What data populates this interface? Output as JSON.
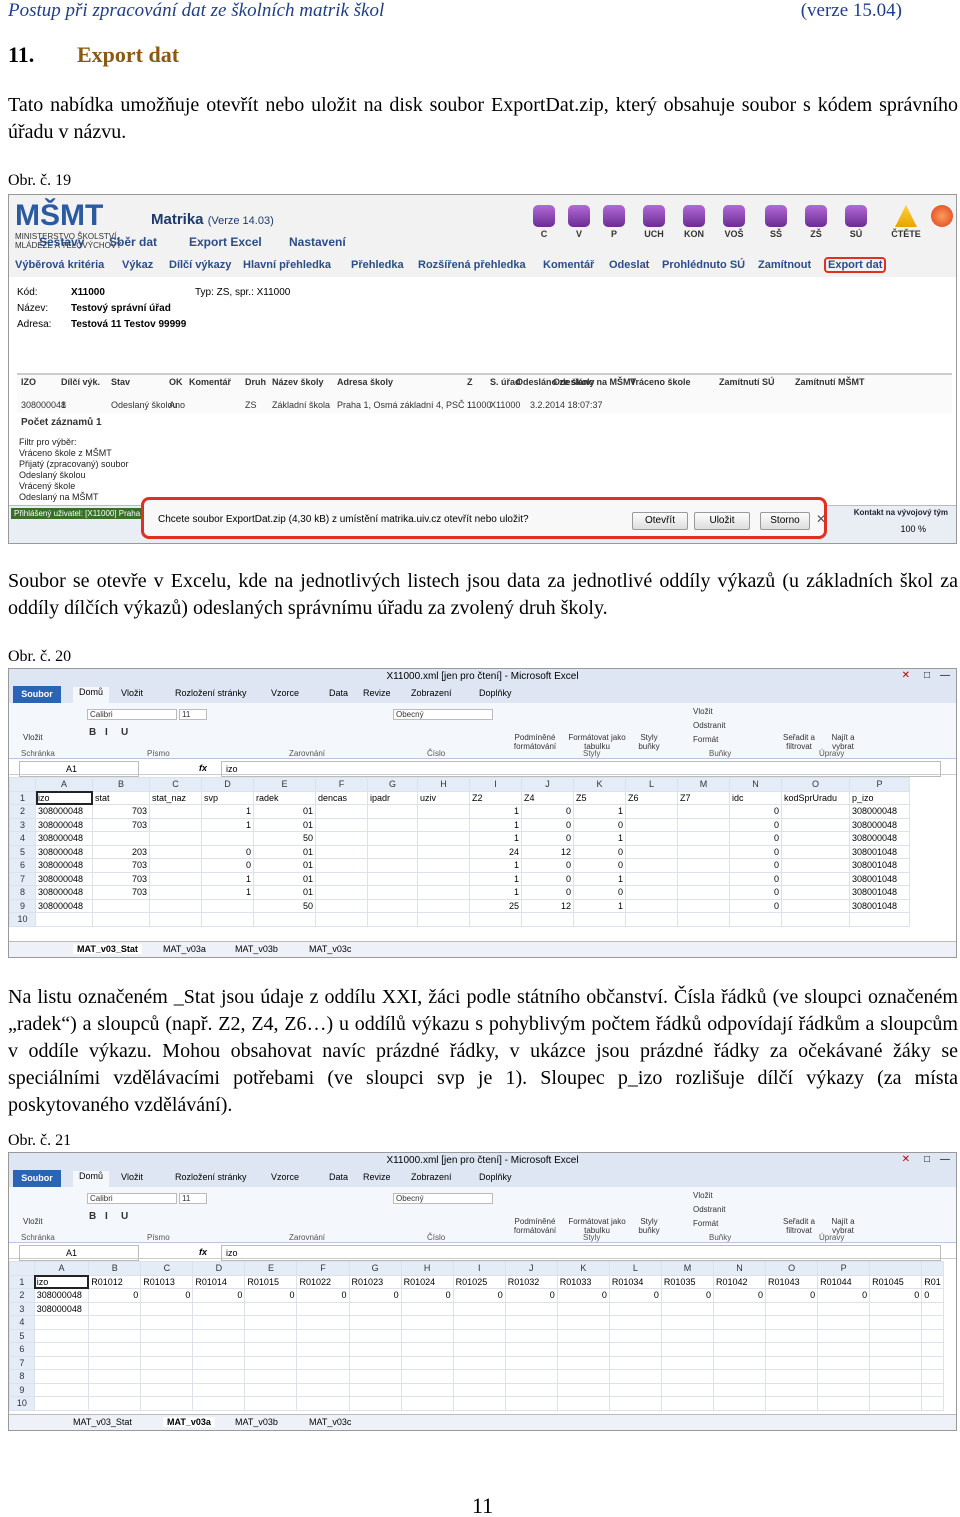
{
  "header": {
    "title": "Postup při zpracování dat ze školních matrik škol",
    "version": "(verze 15.04)"
  },
  "section": {
    "number": "11.",
    "title": "Export dat"
  },
  "para1": "Tato nabídka umožňuje otevřít nebo uložit na disk soubor ExportDat.zip, který obsahuje soubor s kódem správního úřadu v názvu.",
  "cap19": "Obr. č. 19",
  "para2": "Soubor se otevře v Excelu, kde na jednotlivých listech jsou data za jednotlivé oddíly výkazů (u základních škol za oddíly dílčích výkazů) odeslaných správnímu úřadu za zvolený druh školy.",
  "cap20": "Obr. č. 20",
  "para3": "Na listu označeném _Stat jsou údaje z oddílu XXI, žáci podle státního občanství. Čísla řádků (ve sloupci označeném „radek“) a sloupců (např. Z2, Z4, Z6…) u oddílů výkazu s pohyblivým počtem řádků odpovídají řádkům a sloupcům v oddíle výkazu. Mohou obsahovat navíc prázdné řádky, v ukázce jsou prázdné řádky za očekávané žáky se speciálními vzdělávacími potřebami (ve sloupci svp je 1). Sloupec p_izo rozlišuje dílčí výkazy (za místa poskytovaného vzdělávání).",
  "cap21": "Obr. č. 21",
  "page_number": "11",
  "fig19": {
    "logo": "MŠMT",
    "logo_sub": "MINISTERSTVO ŠKOLSTVÍ, MLÁDEŽE A TĚLOVÝCHOVY",
    "title": "Matrika",
    "version": "(Verze 14.03)",
    "icons": [
      "C",
      "V",
      "P",
      "UCH",
      "KON",
      "VOŠ",
      "SŠ",
      "ZŠ",
      "SÚ"
    ],
    "icon_warn": "ČTĚTE",
    "nav1": [
      "Sestavy",
      "Sběr dat",
      "Export Excel",
      "Nastavení"
    ],
    "nav2": [
      "Výběrová kritéria",
      "Výkaz",
      "Dílčí výkazy",
      "Hlavní přehledka",
      "Přehledka",
      "Rozšířená přehledka",
      "Komentář",
      "Odeslat",
      "Prohlédnuto SÚ",
      "Zamítnout",
      "Export dat"
    ],
    "info": {
      "kod_label": "Kód:",
      "kod": "X11000",
      "typ": "Typ: ZS, spr.: X11000",
      "nazev_label": "Název:",
      "nazev": "Testový správní úřad",
      "adresa_label": "Adresa:",
      "adresa": "Testová 11 Testov 99999"
    },
    "cols": [
      "IZO",
      "Dílčí výk.",
      "Stav",
      "OK",
      "Komentář",
      "Druh",
      "Název školy",
      "Adresa školy",
      "Z",
      "S. úřad",
      "Odesláno ze školy",
      "Odesláno na MŠMT",
      "Vráceno škole",
      "Zamítnutí SÚ",
      "Zamítnutí MŠMT"
    ],
    "row": [
      "308000048",
      "1",
      "Odeslaný školou",
      "Ano",
      "ZS",
      "Základní škola",
      "Praha 1, Osmá základní 4, PSČ 11000",
      "1",
      "X11000",
      "3.2.2014 18:07:37"
    ],
    "count": "Počet záznamů 1",
    "filters": [
      "Filtr pro výběr:",
      "Vráceno škole z MŠMT",
      "Přijatý (zpracovaný) soubor",
      "Odeslaný školou",
      "Vrácený škole",
      "Odeslaný na MŠMT"
    ],
    "user": "Přihlášený uživatel: [X11000] Praha",
    "dialog": "Chcete soubor ExportDat.zip (4,30 kB) z umístění matrika.uiv.cz otevřít nebo uložit?",
    "btn_open": "Otevřít",
    "btn_save": "Uložit",
    "btn_cancel": "Storno",
    "contact": "Kontakt na vývojový tým",
    "zoom": "100 %"
  },
  "excel": {
    "title": "X11000.xml [jen pro čtení] - Microsoft Excel",
    "file_tab": "Soubor",
    "tabs": [
      "Domů",
      "Vložit",
      "Rozložení stránky",
      "Vzorce",
      "Data",
      "Revize",
      "Zobrazení",
      "Doplňky"
    ],
    "font": "Calibri",
    "size": "11",
    "format": "Obecný",
    "paste": "Vložit",
    "groups": [
      "Schránka",
      "Písmo",
      "Zarovnání",
      "Číslo",
      "Styly",
      "Buňky",
      "Úpravy"
    ],
    "styles": [
      "Podmíněné formátování",
      "Formátovat jako tabulku",
      "Styly buňky"
    ],
    "cells": [
      "Vložit",
      "Odstranit",
      "Formát"
    ],
    "edit": [
      "Seřadit a filtrovat",
      "Najít a vybrat"
    ],
    "cell_ref": "A1",
    "fx": "fx",
    "formula": "izo"
  },
  "fig20": {
    "columns": [
      "A",
      "B",
      "C",
      "D",
      "E",
      "F",
      "G",
      "H",
      "I",
      "J",
      "K",
      "L",
      "M",
      "N",
      "O",
      "P"
    ],
    "rows": [
      [
        "izo",
        "stat",
        "stat_naz",
        "svp",
        "radek",
        "dencas",
        "ipadr",
        "uziv",
        "Z2",
        "Z4",
        "Z5",
        "Z6",
        "Z7",
        "idc",
        "kodSprUradu",
        "p_izo"
      ],
      [
        "308000048",
        "703",
        "",
        "1",
        "01",
        "",
        "",
        "",
        "1",
        "0",
        "1",
        "",
        "",
        "0",
        "",
        "308000048"
      ],
      [
        "308000048",
        "703",
        "",
        "1",
        "01",
        "",
        "",
        "",
        "1",
        "0",
        "0",
        "",
        "",
        "0",
        "",
        "308000048"
      ],
      [
        "308000048",
        "",
        "",
        "",
        "50",
        "",
        "",
        "",
        "1",
        "0",
        "1",
        "",
        "",
        "0",
        "",
        "308000048"
      ],
      [
        "308000048",
        "203",
        "",
        "0",
        "01",
        "",
        "",
        "",
        "24",
        "12",
        "0",
        "",
        "",
        "0",
        "",
        "308001048"
      ],
      [
        "308000048",
        "703",
        "",
        "0",
        "01",
        "",
        "",
        "",
        "1",
        "0",
        "0",
        "",
        "",
        "0",
        "",
        "308001048"
      ],
      [
        "308000048",
        "703",
        "",
        "1",
        "01",
        "",
        "",
        "",
        "1",
        "0",
        "1",
        "",
        "",
        "0",
        "",
        "308001048"
      ],
      [
        "308000048",
        "703",
        "",
        "1",
        "01",
        "",
        "",
        "",
        "1",
        "0",
        "0",
        "",
        "",
        "0",
        "",
        "308001048"
      ],
      [
        "308000048",
        "",
        "",
        "",
        "50",
        "",
        "",
        "",
        "25",
        "12",
        "1",
        "",
        "",
        "0",
        "",
        "308001048"
      ],
      [
        "",
        "",
        "",
        "",
        "",
        "",
        "",
        "",
        "",
        "",
        "",
        "",
        "",
        "",
        "",
        ""
      ],
      [
        "",
        "",
        "",
        "",
        "",
        "",
        "",
        "",
        "",
        "",
        "",
        "",
        "",
        "",
        "",
        ""
      ]
    ],
    "sheets": [
      "MAT_v03_Stat",
      "MAT_v03a",
      "MAT_v03b",
      "MAT_v03c"
    ]
  },
  "fig21": {
    "columns": [
      "A",
      "B",
      "C",
      "D",
      "E",
      "F",
      "G",
      "H",
      "I",
      "J",
      "K",
      "L",
      "M",
      "N",
      "O",
      "P"
    ],
    "rows": [
      [
        "izo",
        "R01012",
        "R01013",
        "R01014",
        "R01015",
        "R01022",
        "R01023",
        "R01024",
        "R01025",
        "R01032",
        "R01033",
        "R01034",
        "R01035",
        "R01042",
        "R01043",
        "R01044",
        "R01045",
        "R01"
      ],
      [
        "308000048",
        "0",
        "0",
        "0",
        "0",
        "0",
        "0",
        "0",
        "0",
        "0",
        "0",
        "0",
        "0",
        "0",
        "0",
        "0",
        "0",
        "0"
      ],
      [
        "308000048",
        "",
        "",
        "",
        "",
        "",
        "",
        "",
        "",
        "",
        "",
        "",
        "",
        "",
        "",
        "",
        "",
        ""
      ]
    ],
    "sheets": [
      "MAT_v03_Stat",
      "MAT_v03a",
      "MAT_v03b",
      "MAT_v03c"
    ]
  }
}
